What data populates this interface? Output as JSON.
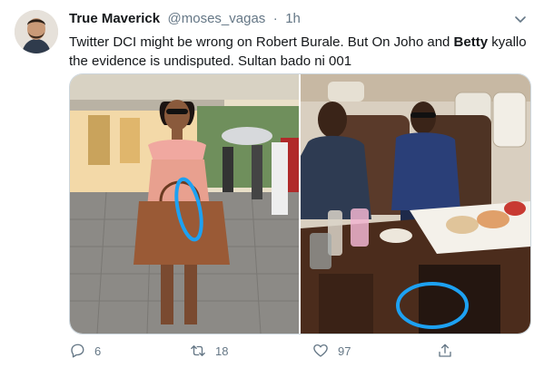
{
  "tweet": {
    "display_name": "True Maverick",
    "handle": "@moses_vagas",
    "separator": "·",
    "time": "1h",
    "text_part1": "Twitter DCI might be wrong on Robert Burale. But On Joho and ",
    "text_bold": "Betty",
    "text_part2": " kyallo the evidence is undisputed. Sultan bado ni 001"
  },
  "actions": {
    "replies": "6",
    "retweets": "18",
    "likes": "97"
  },
  "icons": {
    "reply": "reply-icon",
    "retweet": "retweet-icon",
    "like": "heart-icon",
    "share": "share-icon",
    "more": "chevron-down-icon"
  },
  "colors": {
    "text_primary": "#14171a",
    "text_secondary": "#657786",
    "annotation_circle": "#1da1f2"
  }
}
